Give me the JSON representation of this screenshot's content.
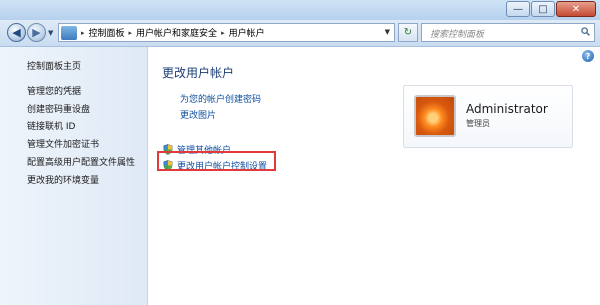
{
  "window": {
    "minimize_glyph": "—",
    "maximize_glyph": "□",
    "close_glyph": "✕"
  },
  "nav": {
    "back_glyph": "◀",
    "forward_glyph": "▶",
    "dropdown_glyph": "▼",
    "breadcrumb": [
      "控制面板",
      "用户帐户和家庭安全",
      "用户帐户"
    ],
    "separator": "▸",
    "refresh_glyph": "↻",
    "search_placeholder": "搜索控制面板"
  },
  "sidebar": {
    "items": [
      {
        "label": "控制面板主页"
      },
      {
        "label": "管理您的凭据"
      },
      {
        "label": "创建密码重设盘"
      },
      {
        "label": "链接联机 ID"
      },
      {
        "label": "管理文件加密证书"
      },
      {
        "label": "配置高级用户配置文件属性"
      },
      {
        "label": "更改我的环境变量"
      }
    ]
  },
  "main": {
    "help_glyph": "?",
    "title": "更改用户帐户",
    "tasks": [
      {
        "label": "为您的帐户创建密码"
      },
      {
        "label": "更改图片"
      }
    ],
    "shield_tasks": [
      {
        "label": "管理其他帐户"
      },
      {
        "label": "更改用户帐户控制设置"
      }
    ],
    "account": {
      "name": "Administrator",
      "role": "管理员"
    }
  },
  "colors": {
    "link": "#0f4fa0",
    "title": "#1e3f76",
    "highlight_border": "#e23a3a"
  }
}
